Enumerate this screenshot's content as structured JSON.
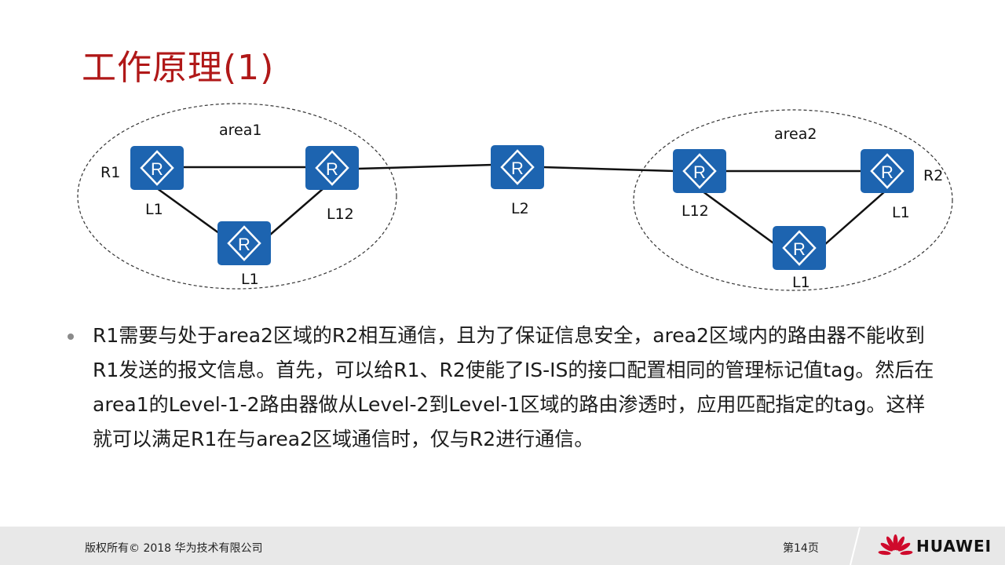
{
  "title": "工作原理(1)",
  "diagram": {
    "areas": [
      {
        "label": "area1"
      },
      {
        "label": "area2"
      }
    ],
    "router_names": {
      "r1": "R1",
      "r2": "R2"
    },
    "router_levels": {
      "r1": "L1",
      "area1_border": "L12",
      "area1_bottom": "L1",
      "middle": "L2",
      "area2_border": "L12",
      "r2": "L1",
      "area2_bottom": "L1"
    },
    "colors": {
      "router": "#1d64b0",
      "link": "#111111",
      "area_outline": "#333333"
    }
  },
  "body_text": "R1需要与处于area2区域的R2相互通信，且为了保证信息安全，area2区域内的路由器不能收到R1发送的报文信息。首先，可以给R1、R2使能了IS-IS的接口配置相同的管理标记值tag。然后在area1的Level-1-2路由器做从Level-2到Level-1区域的路由渗透时，应用匹配指定的tag。这样就可以满足R1在与area2区域通信时，仅与R2进行通信。",
  "footer": {
    "copyright": "版权所有© 2018 华为技术有限公司",
    "page": "第14页",
    "brand": "HUAWEI"
  },
  "colors": {
    "title": "#b01818",
    "footer_bg": "#e8e8e8",
    "brand_red": "#cf0a2c"
  }
}
